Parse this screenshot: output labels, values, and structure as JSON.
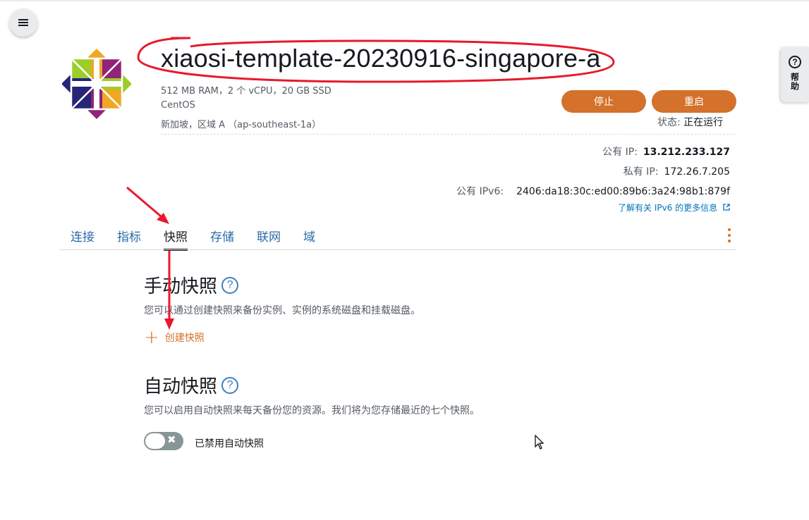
{
  "instance": {
    "name": "xiaosi-template-20230916-singapore-a",
    "specs": "512 MB RAM，2 个 vCPU，20 GB SSD",
    "os": "CentOS",
    "region": "新加坡，区域 A （ap-southeast-1a）",
    "status_label": "状态:",
    "status_value": "正在运行"
  },
  "buttons": {
    "stop": "停止",
    "reboot": "重启"
  },
  "network": {
    "public_ip_label": "公有 IP:",
    "public_ip": "13.212.233.127",
    "private_ip_label": "私有 IP:",
    "private_ip": "172.26.7.205",
    "ipv6_label": "公有 IPv6:",
    "ipv6": "2406:da18:30c:ed00:89b6:3a24:98b1:879f",
    "learn_more": "了解有关 IPv6 的更多信息"
  },
  "tabs": [
    {
      "label": "连接"
    },
    {
      "label": "指标"
    },
    {
      "label": "快照",
      "active": true
    },
    {
      "label": "存储"
    },
    {
      "label": "联网"
    },
    {
      "label": "域"
    }
  ],
  "manual": {
    "heading": "手动快照",
    "desc": "您可以通过创建快照来备份实例、实例的系统磁盘和挂载磁盘。",
    "create": "创建快照"
  },
  "auto": {
    "heading": "自动快照",
    "desc": "您可以启用自动快照来每天备份您的资源。我们将为您存储最近的七个快照。",
    "toggle_label": "已禁用自动快照",
    "enabled": false
  },
  "help_tab": "帮助",
  "colors": {
    "accent": "#d4712a",
    "link": "#2c6aa8",
    "annotation": "#e8192c"
  },
  "icons": [
    "menu-icon",
    "help-icon",
    "centos-logo",
    "info-icon",
    "external-link-icon",
    "plus-icon",
    "close-icon",
    "kebab-menu-icon",
    "mouse-cursor-icon"
  ]
}
